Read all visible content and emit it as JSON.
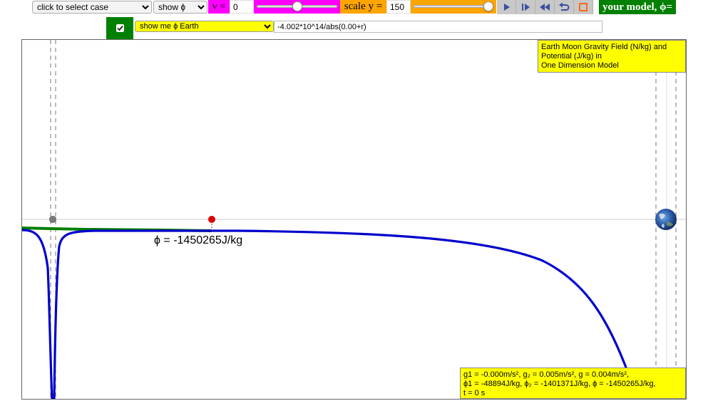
{
  "toolbar": {
    "case_select": "click to select case",
    "show_select": "show ϕ",
    "v_label": "v =",
    "v_value": "0",
    "scale_label": "scale y =",
    "scale_value": "150",
    "model_label": "your model, ϕ=",
    "v_slider_level": 0.5,
    "scale_slider_level": 1.0
  },
  "formula_row": {
    "checkbox_checked": true,
    "show_me_select": "show me ϕ Earth",
    "formula": "-4.002*10^14/abs(0.00+r)"
  },
  "graph": {
    "title_line1": "Earth Moon Gravity Field (N/kg) and",
    "title_line2": "Potential (J/kg) in",
    "title_line3": "One Dimension Model",
    "phi_readout": "ϕ = -1450265J/kg",
    "curve_color": "#0000cc",
    "field_color": "#008000",
    "probe_color": "#dd0000"
  },
  "status": {
    "line1": "g1 = -0.000m/s², g₂ = 0.005m/s², g = 0.004m/s²,",
    "line2": "ϕ1 = -48894J/kg, ϕ₂ = -1401371J/kg, ϕ = -1450265J/kg,",
    "line3": "t = 0 s"
  },
  "colors": {
    "magenta": "#ff00ff",
    "orange": "#ffa500",
    "green": "#008000",
    "yellow": "#ffff00"
  }
}
